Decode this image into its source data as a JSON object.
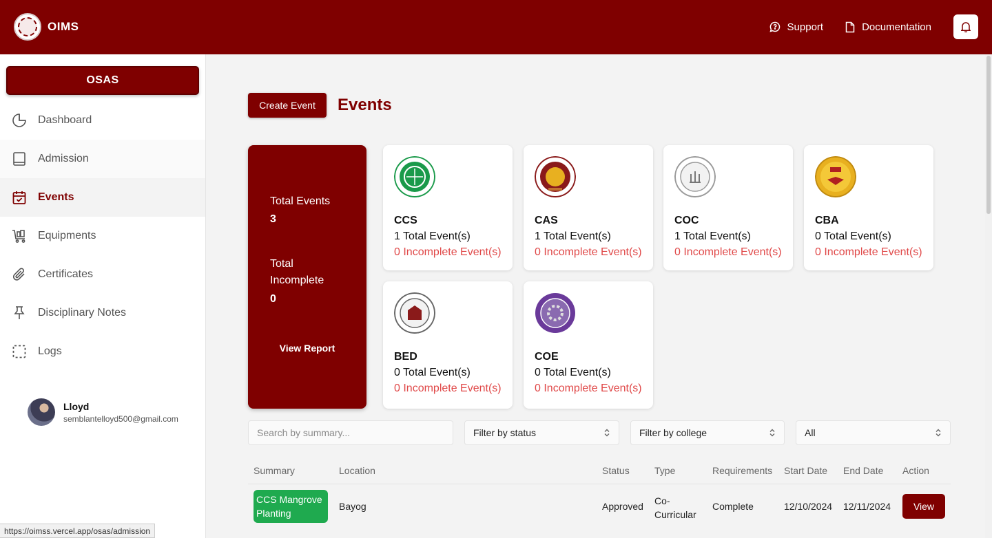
{
  "header": {
    "app_name": "OIMS",
    "support_label": "Support",
    "documentation_label": "Documentation"
  },
  "sidebar": {
    "org_label": "OSAS",
    "items": [
      {
        "label": "Dashboard",
        "icon": "pie-chart-icon"
      },
      {
        "label": "Admission",
        "icon": "book-icon"
      },
      {
        "label": "Events",
        "icon": "calendar-check-icon",
        "active": true
      },
      {
        "label": "Equipments",
        "icon": "cart-icon"
      },
      {
        "label": "Certificates",
        "icon": "paperclip-icon"
      },
      {
        "label": "Disciplinary Notes",
        "icon": "pin-icon"
      },
      {
        "label": "Logs",
        "icon": "dashed-square-icon"
      }
    ],
    "user": {
      "name": "Lloyd",
      "email": "semblantelloyd500@gmail.com"
    }
  },
  "status_bar_url": "https://oimss.vercel.app/osas/admission",
  "page": {
    "create_button": "Create Event",
    "title": "Events"
  },
  "totals": {
    "total_events_label": "Total Events",
    "total_events_value": "3",
    "total_incomplete_label": "Total Incomplete",
    "total_incomplete_value": "0",
    "view_report_label": "View Report"
  },
  "colleges": [
    {
      "code": "CCS",
      "total": "1 Total Event(s)",
      "incomplete": "0 Incomplete Event(s)",
      "logo_color": "#1a9a4a"
    },
    {
      "code": "CAS",
      "total": "1 Total Event(s)",
      "incomplete": "0 Incomplete Event(s)",
      "logo_color": "#8a1a1a"
    },
    {
      "code": "COC",
      "total": "1 Total Event(s)",
      "incomplete": "0 Incomplete Event(s)",
      "logo_color": "#9a9a9a"
    },
    {
      "code": "CBA",
      "total": "0 Total Event(s)",
      "incomplete": "0 Incomplete Event(s)",
      "logo_color": "#e8b020"
    },
    {
      "code": "BED",
      "total": "0 Total Event(s)",
      "incomplete": "0 Incomplete Event(s)",
      "logo_color": "#8a1a1a"
    },
    {
      "code": "COE",
      "total": "0 Total Event(s)",
      "incomplete": "0 Incomplete Event(s)",
      "logo_color": "#6a3a9a"
    }
  ],
  "filters": {
    "search_placeholder": "Search by summary...",
    "status_value": "Filter by status",
    "college_value": "Filter by college",
    "type_value": "All"
  },
  "table": {
    "headers": [
      "Summary",
      "Location",
      "Status",
      "Type",
      "Requirements",
      "Start Date",
      "End Date",
      "Action"
    ],
    "rows": [
      {
        "summary": "CCS Mangrove Planting",
        "location": "Bayog",
        "status": "Approved",
        "type": "Co-Curricular",
        "requirements": "Complete",
        "start_date": "12/10/2024",
        "end_date": "12/11/2024",
        "action": "View"
      }
    ]
  },
  "colors": {
    "primary": "#7f0000",
    "incomplete_text": "#e04848",
    "summary_pill": "#1faa4f"
  }
}
